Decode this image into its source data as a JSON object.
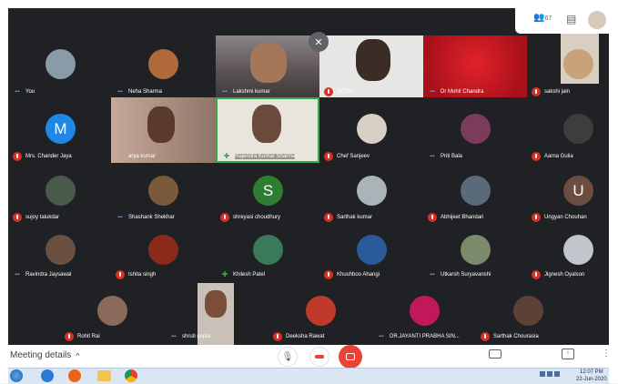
{
  "topbar": {
    "participant_count": "67",
    "chat_icon": "chat-icon",
    "user_icon": "user-avatar-icon"
  },
  "close_symbol": "✕",
  "participants": [
    {
      "name": "You",
      "indicator": "dots",
      "avatar_color": "#8a9ba8"
    },
    {
      "name": "Neha Sharma",
      "indicator": "dots",
      "avatar_color": "#b06a3a"
    },
    {
      "name": "Lakshmi kumar",
      "indicator": "dots",
      "video": true
    },
    {
      "name": "NCRM",
      "indicator": "mute",
      "video": true
    },
    {
      "name": "Dr Mohit Chandra",
      "indicator": "dots",
      "video": true
    },
    {
      "name": "sakshi jain",
      "indicator": "mute",
      "avatar_color": "#c9a27a"
    },
    {
      "name": "Mrs. Chander Jaya",
      "indicator": "mute",
      "initial": "M",
      "avatar_color": "#1e88e5"
    },
    {
      "name": "arya kumar",
      "indicator": "dots",
      "video": true
    },
    {
      "name": "Rajendra Kumar Sharma",
      "indicator": "speak",
      "video": true
    },
    {
      "name": "Chef Sanjeev",
      "indicator": "mute",
      "avatar_color": "#d8d0c4"
    },
    {
      "name": "Priti Bala",
      "indicator": "dots",
      "avatar_color": "#7b3b5a"
    },
    {
      "name": "Aarna Gulia",
      "indicator": "mute",
      "avatar_color": "#3d3d3d"
    },
    {
      "name": "sujoy talukdar",
      "indicator": "mute",
      "avatar_color": "#4a5a4a"
    },
    {
      "name": "Shashank Shekhar",
      "indicator": "dots",
      "avatar_color": "#7a5a3a"
    },
    {
      "name": "shreyasi choudhury",
      "indicator": "mute",
      "initial": "S",
      "avatar_color": "#2e7d32"
    },
    {
      "name": "Sarthak kumar",
      "indicator": "mute",
      "avatar_color": "#aab4b8"
    },
    {
      "name": "Abhijeet Bhandari",
      "indicator": "mute",
      "avatar_color": "#5a6a7a"
    },
    {
      "name": "Ungyan Chouhan",
      "indicator": "mute",
      "initial": "U",
      "avatar_color": "#6d4c41"
    },
    {
      "name": "Ravindra Jaysawal",
      "indicator": "dots",
      "avatar_color": "#6a5040"
    },
    {
      "name": "Ishita singh",
      "indicator": "mute",
      "avatar_color": "#8b2a1a"
    },
    {
      "name": "Khilesh Patel",
      "indicator": "speak",
      "avatar_color": "#3a7a5a"
    },
    {
      "name": "Khushboo Ahangi",
      "indicator": "mute",
      "avatar_color": "#2a5a9a"
    },
    {
      "name": "Utkarsh Suryavanshi",
      "indicator": "dots",
      "avatar_color": "#7a8a6a"
    },
    {
      "name": "Jignesh Oyalson",
      "indicator": "mute",
      "avatar_color": "#c0c6cc"
    },
    {
      "name": "Rohit Rai",
      "indicator": "mute",
      "avatar_color": "#8a6a5a"
    },
    {
      "name": "shruti gupta",
      "indicator": "dots",
      "video": true
    },
    {
      "name": "Deeksha Rawat",
      "indicator": "mute",
      "avatar_color": "#c0392b"
    },
    {
      "name": "DR.JAYANTI PRABHA SIN...",
      "indicator": "dots",
      "avatar_color": "#c2185b"
    },
    {
      "name": "Sarthak Chourasia",
      "indicator": "mute",
      "avatar_color": "#5d4037"
    }
  ],
  "controls": {
    "meeting_details": "Meeting details",
    "chevron": "^",
    "mic_icon": "microphone-icon",
    "hangup_icon": "hangup-icon",
    "camera_icon": "camera-off-icon",
    "captions_icon": "captions-icon",
    "present_icon": "present-icon",
    "more_icon": "more-icon"
  },
  "taskbar": {
    "start_icon": "windows-start-icon",
    "apps": [
      "ie-icon",
      "firefox-icon",
      "explorer-icon",
      "chrome-icon"
    ],
    "time": "12:07 PM",
    "date": "22-Jun-2020"
  },
  "colors": {
    "meet_bg": "#202124",
    "mute_red": "#d93025",
    "hangup_red": "#ea4335",
    "accent_blue": "#1a73e8"
  }
}
